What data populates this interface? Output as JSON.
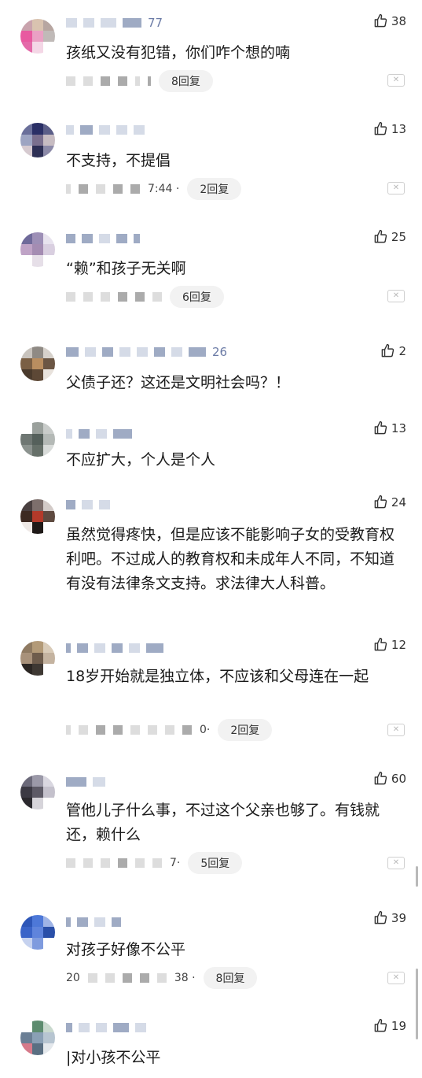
{
  "comments": [
    {
      "likes": "38",
      "text": "孩纸又没有犯错，你们咋个想的喃",
      "name_tail": "77",
      "meta_frag": "",
      "replies": "8回复"
    },
    {
      "likes": "13",
      "text": "不支持，不提倡",
      "name_tail": "",
      "meta_frag": "7:44 ·",
      "replies": "2回复"
    },
    {
      "likes": "25",
      "text": "“赖”和孩子无关啊",
      "name_tail": "",
      "meta_frag": "",
      "replies": "6回复"
    },
    {
      "likes": "2",
      "text": "父债子还？这还是文明社会吗？！",
      "name_tail": "26",
      "meta_frag": "",
      "replies": ""
    },
    {
      "likes": "13",
      "text": "不应扩大，个人是个人",
      "name_tail": "",
      "meta_frag": "",
      "replies": ""
    },
    {
      "likes": "24",
      "text": "虽然觉得疼快，但是应该不能影响子女的受教育权利吧。不过成人的教育权和未成年人不同，不知道有没有法律条文支持。求法律大人科普。",
      "name_tail": "",
      "meta_frag": "",
      "replies": ""
    },
    {
      "likes": "12",
      "text": "18岁开始就是独立体，不应该和父母连在一起",
      "name_tail": "",
      "meta_frag": "0·",
      "replies": "2回复"
    },
    {
      "likes": "60",
      "text": "管他儿子什么事，不过这个父亲也够了。有钱就还，赖什么",
      "name_tail": "",
      "meta_frag": "7·",
      "replies": "5回复"
    },
    {
      "likes": "39",
      "text": "对孩子好像不公平",
      "name_tail": "",
      "meta_frag": "38 ·",
      "meta_prefix": "20",
      "replies": "8回复"
    },
    {
      "likes": "19",
      "text": "|对小孩不公平",
      "name_tail": "",
      "meta_frag": "",
      "replies": ""
    }
  ],
  "icons": {
    "like": "thumbs-up-icon",
    "close": "close-icon"
  },
  "colors": {
    "text": "#1a1a1a",
    "pill_bg": "#f2f2f2"
  }
}
